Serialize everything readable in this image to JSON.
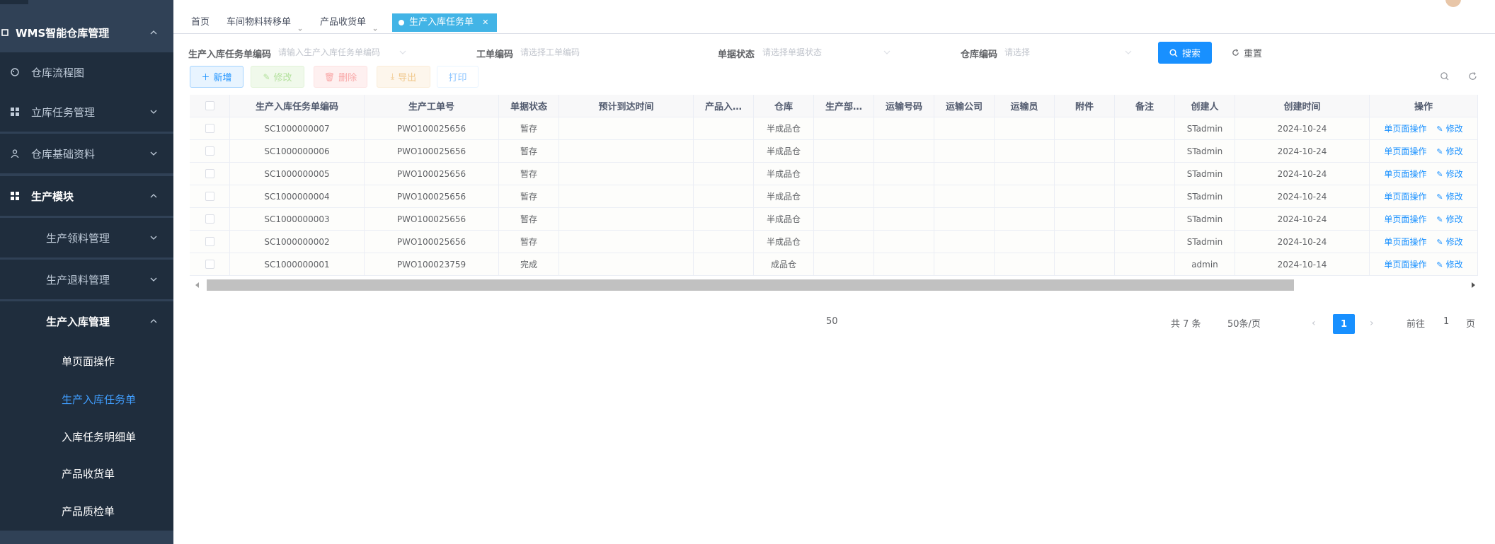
{
  "sidebar": {
    "items": [
      {
        "label": "WMS智能仓库管理",
        "icon": "box-icon",
        "expanded": true
      },
      {
        "label": "仓库流程图",
        "icon": "palette-icon"
      },
      {
        "label": "立库任务管理",
        "icon": "grid-icon",
        "expanded": false
      },
      {
        "label": "仓库基础资料",
        "icon": "user-icon",
        "expanded": false
      },
      {
        "label": "生产模块",
        "icon": "grid-icon",
        "expanded": true
      },
      {
        "label": "生产领料管理",
        "expanded": false
      },
      {
        "label": "生产退料管理",
        "expanded": false
      },
      {
        "label": "生产入库管理",
        "expanded": true
      },
      {
        "label": "单页面操作"
      },
      {
        "label": "生产入库任务单",
        "active": true
      },
      {
        "label": "入库任务明细单"
      },
      {
        "label": "产品收货单"
      },
      {
        "label": "产品质检单"
      }
    ]
  },
  "tabs": [
    {
      "label": "首页"
    },
    {
      "label": "车间物料转移单"
    },
    {
      "label": "产品收货单"
    },
    {
      "label": "生产入库任务单",
      "active": true
    }
  ],
  "search": {
    "fields": [
      {
        "label": "生产入库任务单编码",
        "placeholder": "请输入生产入库任务单编码"
      },
      {
        "label": "工单编码",
        "placeholder": "请选择工单编码"
      },
      {
        "label": "单据状态",
        "placeholder": "请选择单据状态"
      },
      {
        "label": "仓库编码",
        "placeholder": "请选择"
      }
    ],
    "search_label": "搜索",
    "reset_label": "重置"
  },
  "toolbar": {
    "add": "新增",
    "edit": "修改",
    "delete": "删除",
    "export": "导出",
    "print": "打印"
  },
  "table": {
    "columns": [
      "生产入库任务单编码",
      "生产工单号",
      "单据状态",
      "预计到达时间",
      "产品入…",
      "仓库",
      "生产部…",
      "运输号码",
      "运输公司",
      "运输员",
      "附件",
      "备注",
      "创建人",
      "创建时间",
      "操作"
    ],
    "op_page": "单页面操作",
    "op_edit": "修改",
    "rows": [
      {
        "code": "SC1000000007",
        "wo": "PWO100025656",
        "status": "暂存",
        "eta": "",
        "prod": "",
        "wh": "半成品仓",
        "dept": "",
        "tno": "",
        "tco": "",
        "driver": "",
        "att": "",
        "remark": "",
        "creator": "STadmin",
        "created": "2024-10-24"
      },
      {
        "code": "SC1000000006",
        "wo": "PWO100025656",
        "status": "暂存",
        "eta": "",
        "prod": "",
        "wh": "半成品仓",
        "dept": "",
        "tno": "",
        "tco": "",
        "driver": "",
        "att": "",
        "remark": "",
        "creator": "STadmin",
        "created": "2024-10-24"
      },
      {
        "code": "SC1000000005",
        "wo": "PWO100025656",
        "status": "暂存",
        "eta": "",
        "prod": "",
        "wh": "半成品仓",
        "dept": "",
        "tno": "",
        "tco": "",
        "driver": "",
        "att": "",
        "remark": "",
        "creator": "STadmin",
        "created": "2024-10-24"
      },
      {
        "code": "SC1000000004",
        "wo": "PWO100025656",
        "status": "暂存",
        "eta": "",
        "prod": "",
        "wh": "半成品仓",
        "dept": "",
        "tno": "",
        "tco": "",
        "driver": "",
        "att": "",
        "remark": "",
        "creator": "STadmin",
        "created": "2024-10-24"
      },
      {
        "code": "SC1000000003",
        "wo": "PWO100025656",
        "status": "暂存",
        "eta": "",
        "prod": "",
        "wh": "半成品仓",
        "dept": "",
        "tno": "",
        "tco": "",
        "driver": "",
        "att": "",
        "remark": "",
        "creator": "STadmin",
        "created": "2024-10-24"
      },
      {
        "code": "SC1000000002",
        "wo": "PWO100025656",
        "status": "暂存",
        "eta": "",
        "prod": "",
        "wh": "半成品仓",
        "dept": "",
        "tno": "",
        "tco": "",
        "driver": "",
        "att": "",
        "remark": "",
        "creator": "STadmin",
        "created": "2024-10-24"
      },
      {
        "code": "SC1000000001",
        "wo": "PWO100023759",
        "status": "完成",
        "eta": "",
        "prod": "",
        "wh": "成品仓",
        "dept": "",
        "tno": "",
        "tco": "",
        "driver": "",
        "att": "",
        "remark": "",
        "creator": "admin",
        "created": "2024-10-14"
      }
    ]
  },
  "pagination": {
    "page_size_left": "50",
    "total": "共 7 条",
    "page_size": "50条/页",
    "current": "1",
    "goto_label": "前往",
    "goto_value": "1",
    "page_suffix": "页"
  },
  "colors": {
    "sidebar_bg": "#304156",
    "accent": "#1890ff",
    "active_tab": "#42b4e6"
  }
}
